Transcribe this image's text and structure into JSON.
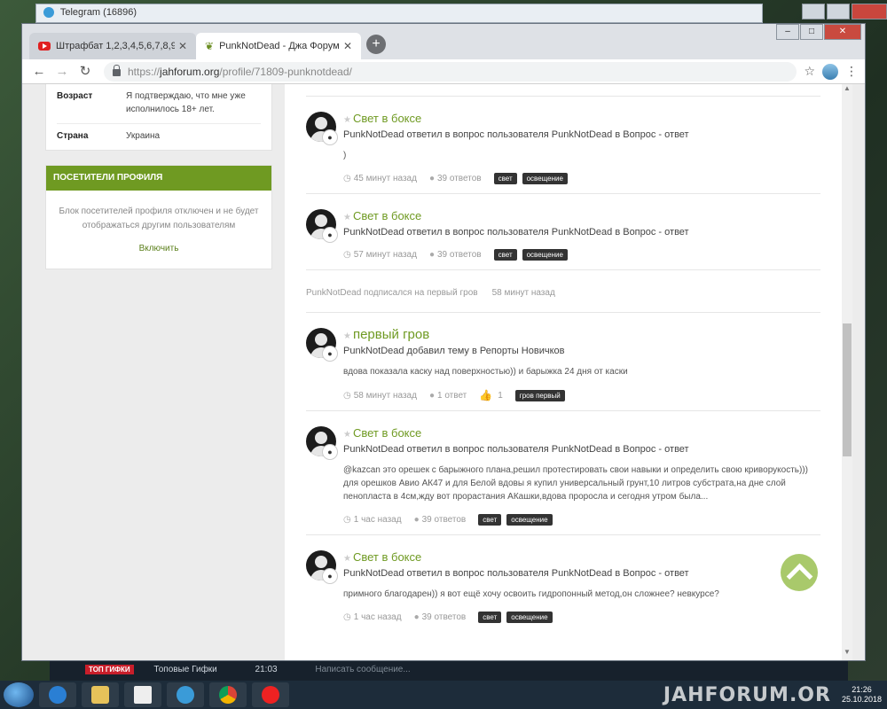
{
  "background": {
    "telegram_title": "Telegram (16896)",
    "peek_badge": "ТОП ГИФКИ",
    "peek_title": "Топовые Гифки",
    "peek_time": "21:03",
    "peek_input": "Написать сообщение..."
  },
  "browser": {
    "tabs": [
      {
        "label": "Штрафбат 1,2,3,4,5,6,7,8,9,10...",
        "active": false
      },
      {
        "label": "PunkNotDead - Джа Форум",
        "active": true
      }
    ],
    "new_tab": "+",
    "url_scheme": "https://",
    "url_host": "jahforum.org",
    "url_path": "/profile/71809-punknotdead/"
  },
  "sidebar": {
    "fields": [
      {
        "label": "Возраст",
        "value": "Я подтверждаю, что мне уже исполнилось 18+ лет."
      },
      {
        "label": "Страна",
        "value": "Украина"
      }
    ],
    "visitors": {
      "header": "ПОСЕТИТЕЛИ ПРОФИЛЯ",
      "message": "Блок посетителей профиля отключен и не будет отображаться другим пользователям",
      "link": "Включить"
    }
  },
  "feed": {
    "entries": [
      {
        "title": "Свет в боксе",
        "meta": "PunkNotDead ответил в вопрос пользователя PunkNotDead в Вопрос - ответ",
        "excerpt": ")",
        "time": "45 минут назад",
        "replies": "39 ответов",
        "tags": [
          "свет",
          "освещение"
        ]
      },
      {
        "title": "Свет в боксе",
        "meta": "PunkNotDead ответил в вопрос пользователя PunkNotDead в Вопрос - ответ",
        "excerpt": "",
        "time": "57 минут назад",
        "replies": "39 ответов",
        "tags": [
          "свет",
          "освещение"
        ]
      },
      {
        "title": "первый гров",
        "meta": "PunkNotDead добавил тему в Репорты Новичков",
        "excerpt": "вдова показала каску над поверхностью)) и барыжка 24 дня от каски",
        "time": "58 минут назад",
        "replies": "1 ответ",
        "likes": "1",
        "tags": [
          "гров первый"
        ]
      },
      {
        "title": "Свет в боксе",
        "meta": "PunkNotDead ответил в вопрос пользователя PunkNotDead в Вопрос - ответ",
        "excerpt": "@kazcan это орешек с барыжного плана,решил протестировать свои навыки и определить свою криворукость))) для орешков Авио АК47 и для Белой вдовы я купил универсальный грунт,10 литров субстрата,на дне слой пенопласта в 4см,жду вот прорастания АКашки,вдова проросла и сегодня утром была...",
        "time": "1 час назад",
        "replies": "39 ответов",
        "tags": [
          "свет",
          "освещение"
        ]
      },
      {
        "title": "Свет в боксе",
        "meta": "PunkNotDead ответил в вопрос пользователя PunkNotDead в Вопрос - ответ",
        "excerpt": "примного благодарен)) я вот ещё хочу освоить гидропонный метод,он сложнее? невкурсе?",
        "time": "1 час назад",
        "replies": "39 ответов",
        "tags": [
          "свет",
          "освещение"
        ]
      }
    ],
    "activity": {
      "text": "PunkNotDead подписался на первый гров",
      "time": "58 минут назад"
    }
  },
  "taskbar": {
    "watermark": "JAHFORUM.OR",
    "clock_time": "21:26",
    "clock_date": "25.10.2018"
  },
  "colors": {
    "accent": "#6f9a22",
    "header_bg": "#6f9a22",
    "tag_bg": "#333333"
  }
}
